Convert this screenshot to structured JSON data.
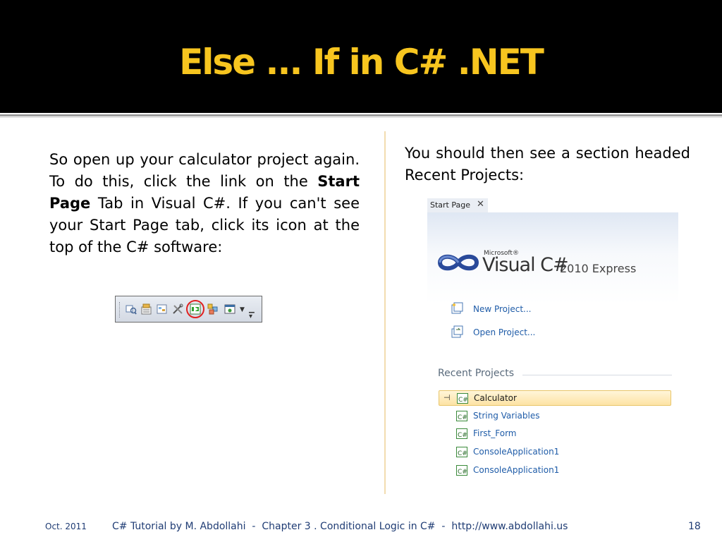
{
  "slide": {
    "title": "Else ... If in C# .NET",
    "left_paragraph": {
      "before": "So open up your calculator project again. To do this, click the link on the ",
      "bold": "Start Page",
      "after": " Tab in Visual C#. If you can't see your Start Page tab, click its icon at the top of the C# software:"
    },
    "right_paragraph": "You should then see a section headed Recent Projects:"
  },
  "start_page": {
    "tab_label": "Start Page",
    "tab_close": "✕",
    "logo_microsoft": "Microsoft®",
    "logo_visual": "Visual C#",
    "logo_edition": "2010 Express",
    "links": {
      "new_project": "New Project...",
      "open_project": "Open Project..."
    },
    "recent_heading": "Recent Projects",
    "recent_items": [
      "Calculator",
      "String Variables",
      "First_Form",
      "ConsoleApplication1",
      "ConsoleApplication1"
    ],
    "icon_text": "C#"
  },
  "footer": {
    "date": "Oct. 2011",
    "center": "C# Tutorial by M. Abdollahi  -  Chapter 3 . Conditional Logic in C#  -  http://www.abdollahi.us",
    "page": "18"
  },
  "colors": {
    "title": "#f7c51f",
    "header_bg": "#000000",
    "footer_text": "#1f3c74",
    "link_blue": "#1f5ca8",
    "highlight_circle": "#e02020"
  }
}
